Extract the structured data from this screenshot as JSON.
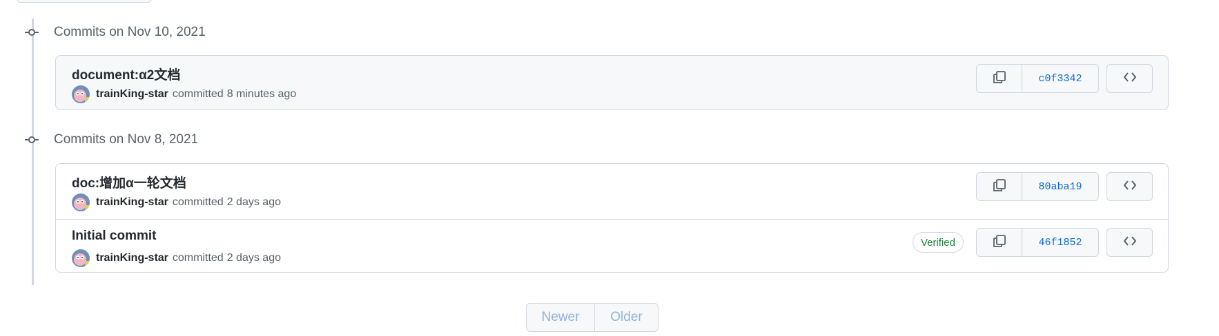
{
  "groups": [
    {
      "title": "Commits on Nov 10, 2021",
      "commits": [
        {
          "message": "document:α2文档",
          "author": "trainKing-star",
          "action": "committed",
          "time": "8 minutes ago",
          "sha": "c0f3342",
          "verified": ""
        }
      ]
    },
    {
      "title": "Commits on Nov 8, 2021",
      "commits": [
        {
          "message": "doc:增加α一轮文档",
          "author": "trainKing-star",
          "action": "committed",
          "time": "2 days ago",
          "sha": "80aba19",
          "verified": ""
        },
        {
          "message": "Initial commit",
          "author": "trainKing-star",
          "action": "committed",
          "time": "2 days ago",
          "sha": "46f1852",
          "verified": "Verified"
        }
      ]
    }
  ],
  "pagination": {
    "newer_label": "Newer",
    "older_label": "Older"
  },
  "icons": {
    "commit_node": "git-commit-icon",
    "copy": "copy-icon",
    "browse": "code-icon",
    "avatar": "avatar"
  },
  "colors": {
    "link": "#0969da",
    "verified": "#1a7f37",
    "muted": "#57606a",
    "border": "#d0d7de",
    "disabled_link": "#8fb2dd"
  }
}
